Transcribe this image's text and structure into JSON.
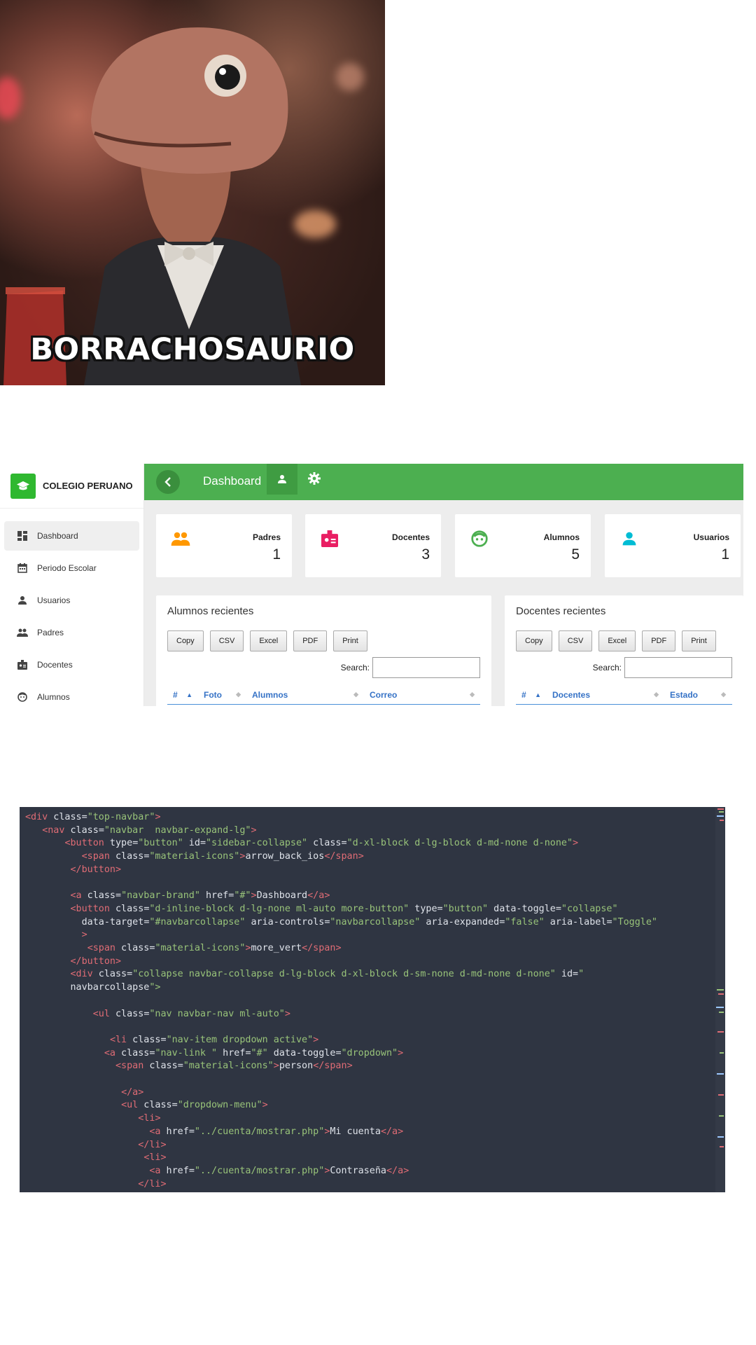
{
  "meme": {
    "caption": "BORRACHOSAURIO"
  },
  "dashboard": {
    "brand": "COLEGIO PERUANO",
    "topbar_title": "Dashboard",
    "sidebar": [
      {
        "label": "Dashboard",
        "icon": "dashboard-icon"
      },
      {
        "label": "Periodo Escolar",
        "icon": "calendar-icon"
      },
      {
        "label": "Usuarios",
        "icon": "person-icon"
      },
      {
        "label": "Padres",
        "icon": "people-icon"
      },
      {
        "label": "Docentes",
        "icon": "badge-icon"
      },
      {
        "label": "Alumnos",
        "icon": "face-icon"
      }
    ],
    "cards": [
      {
        "label": "Padres",
        "value": "1",
        "icon": "people-icon",
        "color": "#ff9800"
      },
      {
        "label": "Docentes",
        "value": "3",
        "icon": "badge-icon",
        "color": "#e91e63"
      },
      {
        "label": "Alumnos",
        "value": "5",
        "icon": "face-icon",
        "color": "#4caf50"
      },
      {
        "label": "Usuarios",
        "value": "1",
        "icon": "person-icon",
        "color": "#00bcd4"
      }
    ],
    "panels": [
      {
        "title": "Alumnos recientes",
        "buttons": [
          "Copy",
          "CSV",
          "Excel",
          "PDF",
          "Print"
        ],
        "search_label": "Search:",
        "columns": [
          "#",
          "Foto",
          "Alumnos",
          "Correo"
        ]
      },
      {
        "title": "Docentes recientes",
        "buttons": [
          "Copy",
          "CSV",
          "Excel",
          "PDF",
          "Print"
        ],
        "search_label": "Search:",
        "columns": [
          "#",
          "Docentes",
          "Estado"
        ]
      }
    ],
    "accent": "#4caf50"
  },
  "code": {
    "lines": [
      "<div class=\"top-navbar\">",
      "   <nav class=\"navbar  navbar-expand-lg\">",
      "       <button type=\"button\" id=\"sidebar-collapse\" class=\"d-xl-block d-lg-block d-md-none d-none\">",
      "          <span class=\"material-icons\">arrow_back_ios</span>",
      "        </button>",
      "",
      "        <a class=\"navbar-brand\" href=\"#\">Dashboard</a>",
      "        <button class=\"d-inline-block d-lg-none ml-auto more-button\" type=\"button\" data-toggle=\"collapse\"",
      "          data-target=\"#navbarcollapse\" aria-controls=\"navbarcollapse\" aria-expanded=\"false\" aria-label=\"Toggle\"",
      "          >",
      "           <span class=\"material-icons\">more_vert</span>",
      "        </button>",
      "        <div class=\"collapse navbar-collapse d-lg-block d-xl-block d-sm-none d-md-none d-none\" id=\"",
      "        navbarcollapse\">",
      "",
      "            <ul class=\"nav navbar-nav ml-auto\">",
      "",
      "               <li class=\"nav-item dropdown active\">",
      "              <a class=\"nav-link \" href=\"#\" data-toggle=\"dropdown\">",
      "                <span class=\"material-icons\">person</span>",
      "",
      "                 </a>",
      "                 <ul class=\"dropdown-menu\">",
      "                    <li>",
      "                      <a href=\"../cuenta/mostrar.php\">Mi cuenta</a>",
      "                    </li>",
      "                     <li>",
      "                      <a href=\"../cuenta/mostrar.php\">Contraseña</a>",
      "                    </li>"
    ]
  }
}
